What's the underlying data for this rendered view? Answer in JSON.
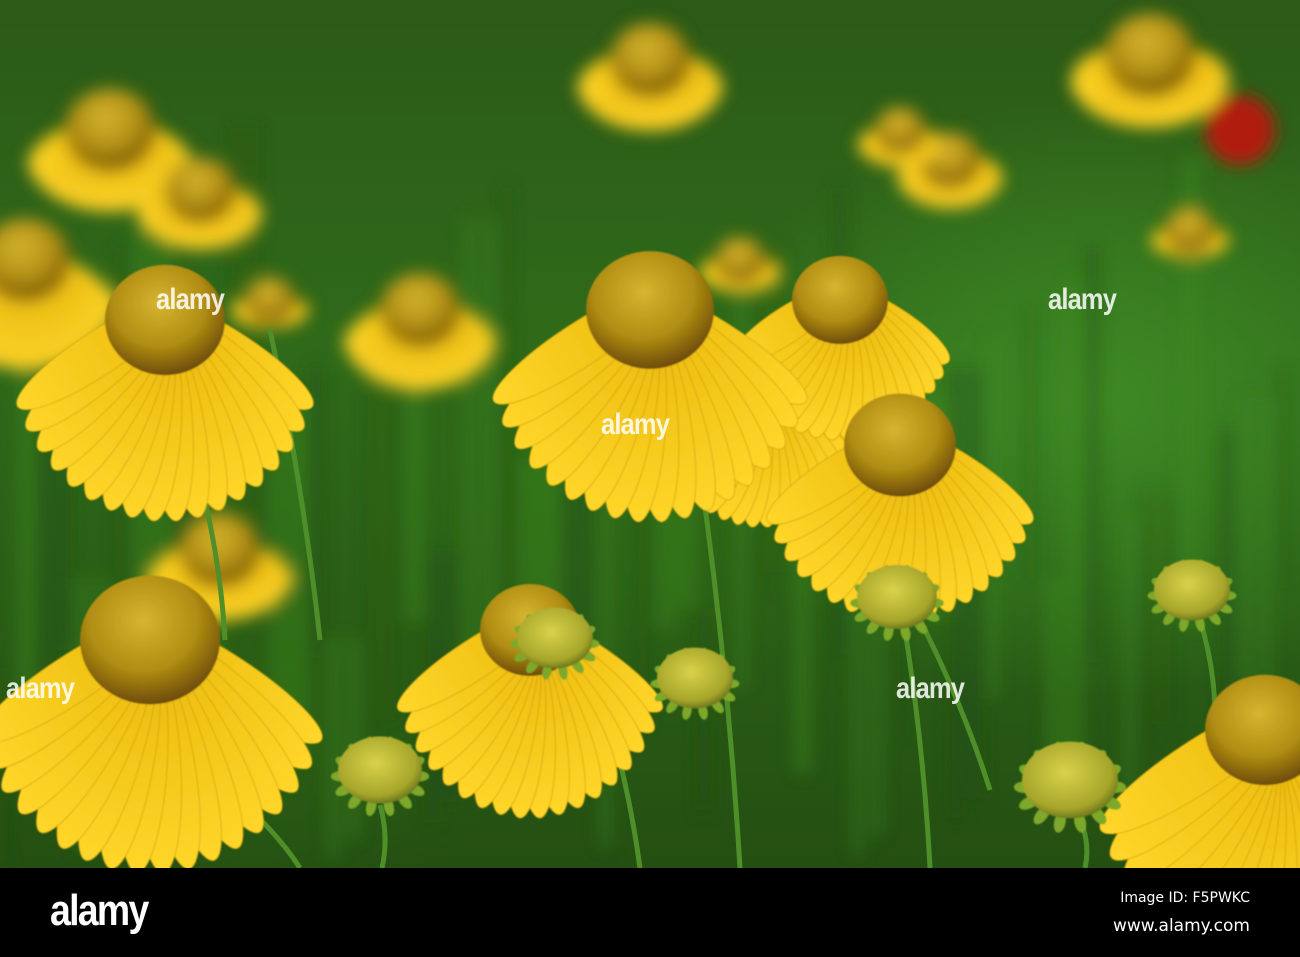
{
  "photo": {
    "watermark_text": "alamy"
  },
  "footer": {
    "logo": "alamy",
    "image_id": "Image ID: F5PWKC",
    "website": "www.alamy.com"
  }
}
